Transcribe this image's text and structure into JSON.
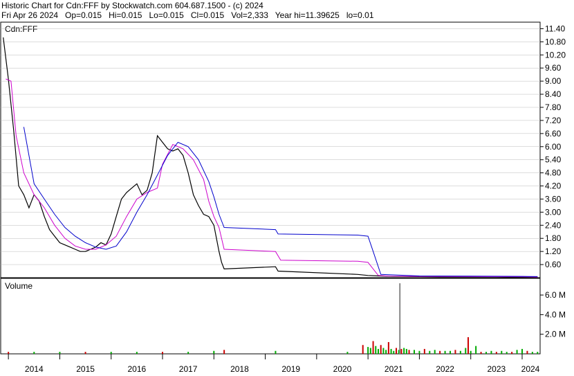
{
  "header": {
    "line1": "Historic Chart for Cdn:FFF by Stockwatch.com 604.687.1500 - (c) 2024",
    "line2": "Fri Apr 26 2024   Op=0.015   Hi=0.015   Lo=0.015   Cl=0.015   Vol=2,333   Year hi=11.39625   lo=0.01"
  },
  "colors": {
    "price": "#000000",
    "ma_short": "#cc00cc",
    "ma_long": "#0000cc",
    "vol_up": "#00aa00",
    "vol_down": "#cc0000",
    "vol_spike": "#888888",
    "grid": "#bbbbbb"
  },
  "chart_data": [
    {
      "type": "line",
      "label": "Cdn:FFF",
      "ylim": [
        0,
        11.7
      ],
      "yticks": [
        "11.40",
        "10.80",
        "10.20",
        "9.60",
        "9.00",
        "8.40",
        "7.80",
        "7.20",
        "6.60",
        "6.00",
        "5.40",
        "4.80",
        "4.20",
        "3.60",
        "3.00",
        "2.40",
        "1.80",
        "1.20",
        "0.60"
      ],
      "x_years": [
        "2014",
        "2015",
        "2016",
        "2017",
        "2018",
        "2019",
        "2020",
        "2021",
        "2022",
        "2023",
        "2024"
      ],
      "series": [
        {
          "x": [
            2013.9,
            2014.0,
            2014.1,
            2014.2,
            2014.3,
            2014.4,
            2014.5,
            2014.6,
            2014.7,
            2014.8,
            2014.9,
            2015.0,
            2015.1,
            2015.2,
            2015.3,
            2015.4,
            2015.5,
            2015.6,
            2015.7,
            2015.8,
            2015.9,
            2016.0,
            2016.1,
            2016.2,
            2016.3,
            2016.4,
            2016.5,
            2016.6,
            2016.7,
            2016.8,
            2016.9,
            2017.0,
            2017.1,
            2017.2,
            2017.3,
            2017.4,
            2017.5,
            2017.6,
            2017.7,
            2017.8,
            2017.9,
            2018.0,
            2018.05,
            2018.1,
            2018.15,
            2018.2,
            2019.2,
            2019.25,
            2020.8,
            2021.0,
            2021.2,
            2021.5,
            2022.0,
            2022.5,
            2023.0,
            2023.5,
            2024.0,
            2024.3
          ],
          "values": [
            11.0,
            9.1,
            6.8,
            4.2,
            3.8,
            3.2,
            3.8,
            3.5,
            2.8,
            2.2,
            1.9,
            1.6,
            1.5,
            1.4,
            1.3,
            1.2,
            1.2,
            1.3,
            1.4,
            1.6,
            1.5,
            2.0,
            2.8,
            3.6,
            3.9,
            4.1,
            4.3,
            3.8,
            4.0,
            4.8,
            6.5,
            6.2,
            5.9,
            5.8,
            5.9,
            5.6,
            4.8,
            3.8,
            3.3,
            2.9,
            2.8,
            2.4,
            1.8,
            1.2,
            0.7,
            0.4,
            0.5,
            0.3,
            0.15,
            0.1,
            0.08,
            0.06,
            0.05,
            0.04,
            0.04,
            0.04,
            0.03,
            0.015
          ]
        },
        {
          "x": [
            2013.95,
            2014.05,
            2014.15,
            2014.3,
            2014.5,
            2014.7,
            2014.9,
            2015.1,
            2015.3,
            2015.5,
            2015.7,
            2015.9,
            2016.1,
            2016.3,
            2016.5,
            2016.7,
            2016.9,
            2017.0,
            2017.2,
            2017.4,
            2017.6,
            2017.8,
            2017.9,
            2018.0,
            2018.1,
            2018.2,
            2019.2,
            2019.3,
            2020.8,
            2021.0,
            2021.2,
            2021.4,
            2022.0,
            2023.0,
            2024.0,
            2024.3
          ],
          "values": [
            9.1,
            9.0,
            6.5,
            4.8,
            3.8,
            3.2,
            2.4,
            1.8,
            1.45,
            1.3,
            1.3,
            1.5,
            1.9,
            2.8,
            3.6,
            3.9,
            4.1,
            5.2,
            6.1,
            5.9,
            5.4,
            4.5,
            3.5,
            2.8,
            2.3,
            1.3,
            1.2,
            0.8,
            0.75,
            0.7,
            0.1,
            0.07,
            0.06,
            0.05,
            0.04,
            0.03
          ]
        },
        {
          "x": [
            2014.3,
            2014.5,
            2014.7,
            2014.9,
            2015.1,
            2015.3,
            2015.5,
            2015.7,
            2015.9,
            2016.1,
            2016.3,
            2016.5,
            2016.7,
            2016.9,
            2017.1,
            2017.3,
            2017.5,
            2017.7,
            2017.9,
            2018.0,
            2018.1,
            2018.2,
            2019.2,
            2019.25,
            2020.8,
            2021.0,
            2021.1,
            2021.25,
            2022.0,
            2023.0,
            2024.0,
            2024.3
          ],
          "values": [
            6.9,
            4.3,
            3.6,
            2.9,
            2.3,
            1.9,
            1.6,
            1.4,
            1.3,
            1.45,
            2.1,
            3.0,
            3.8,
            4.7,
            5.6,
            6.2,
            6.0,
            5.4,
            4.4,
            3.7,
            2.9,
            2.3,
            2.2,
            2.0,
            1.95,
            1.9,
            1.2,
            0.15,
            0.08,
            0.07,
            0.06,
            0.05
          ]
        }
      ]
    },
    {
      "type": "bar",
      "label": "Volume",
      "ylim": [
        0,
        7.7
      ],
      "yticks": [
        "6.0 M",
        "4.0 M",
        "2.0 M"
      ],
      "series": [
        {
          "x": [
            2014.0,
            2014.5,
            2015.0,
            2015.5,
            2016.0,
            2016.5,
            2017.0,
            2017.5,
            2018.0,
            2018.2,
            2019.2,
            2020.6,
            2020.9,
            2021.0,
            2021.05,
            2021.1,
            2021.15,
            2021.2,
            2021.25,
            2021.3,
            2021.35,
            2021.4,
            2021.45,
            2021.5,
            2021.55,
            2021.6,
            2021.62,
            2021.65,
            2021.7,
            2021.75,
            2021.8,
            2021.9,
            2022.0,
            2022.1,
            2022.2,
            2022.3,
            2022.4,
            2022.5,
            2022.6,
            2022.7,
            2022.8,
            2022.9,
            2022.95,
            2023.0,
            2023.1,
            2023.2,
            2023.3,
            2023.4,
            2023.5,
            2023.6,
            2023.7,
            2023.8,
            2023.9,
            2024.0,
            2024.1,
            2024.2,
            2024.3
          ],
          "values": [
            0.2,
            0.2,
            0.2,
            0.2,
            0.2,
            0.2,
            0.2,
            0.2,
            0.3,
            0.4,
            0.3,
            0.2,
            0.9,
            0.7,
            0.6,
            1.3,
            0.8,
            0.5,
            0.9,
            0.6,
            0.4,
            1.2,
            0.5,
            0.3,
            0.6,
            0.4,
            7.2,
            0.5,
            0.6,
            0.5,
            0.4,
            0.4,
            0.3,
            0.5,
            0.3,
            0.4,
            0.3,
            0.3,
            0.3,
            0.4,
            0.3,
            0.6,
            1.7,
            0.3,
            0.8,
            0.2,
            0.2,
            0.3,
            0.2,
            0.3,
            0.2,
            0.2,
            0.4,
            0.5,
            0.3,
            0.2,
            0.2
          ]
        }
      ]
    }
  ]
}
